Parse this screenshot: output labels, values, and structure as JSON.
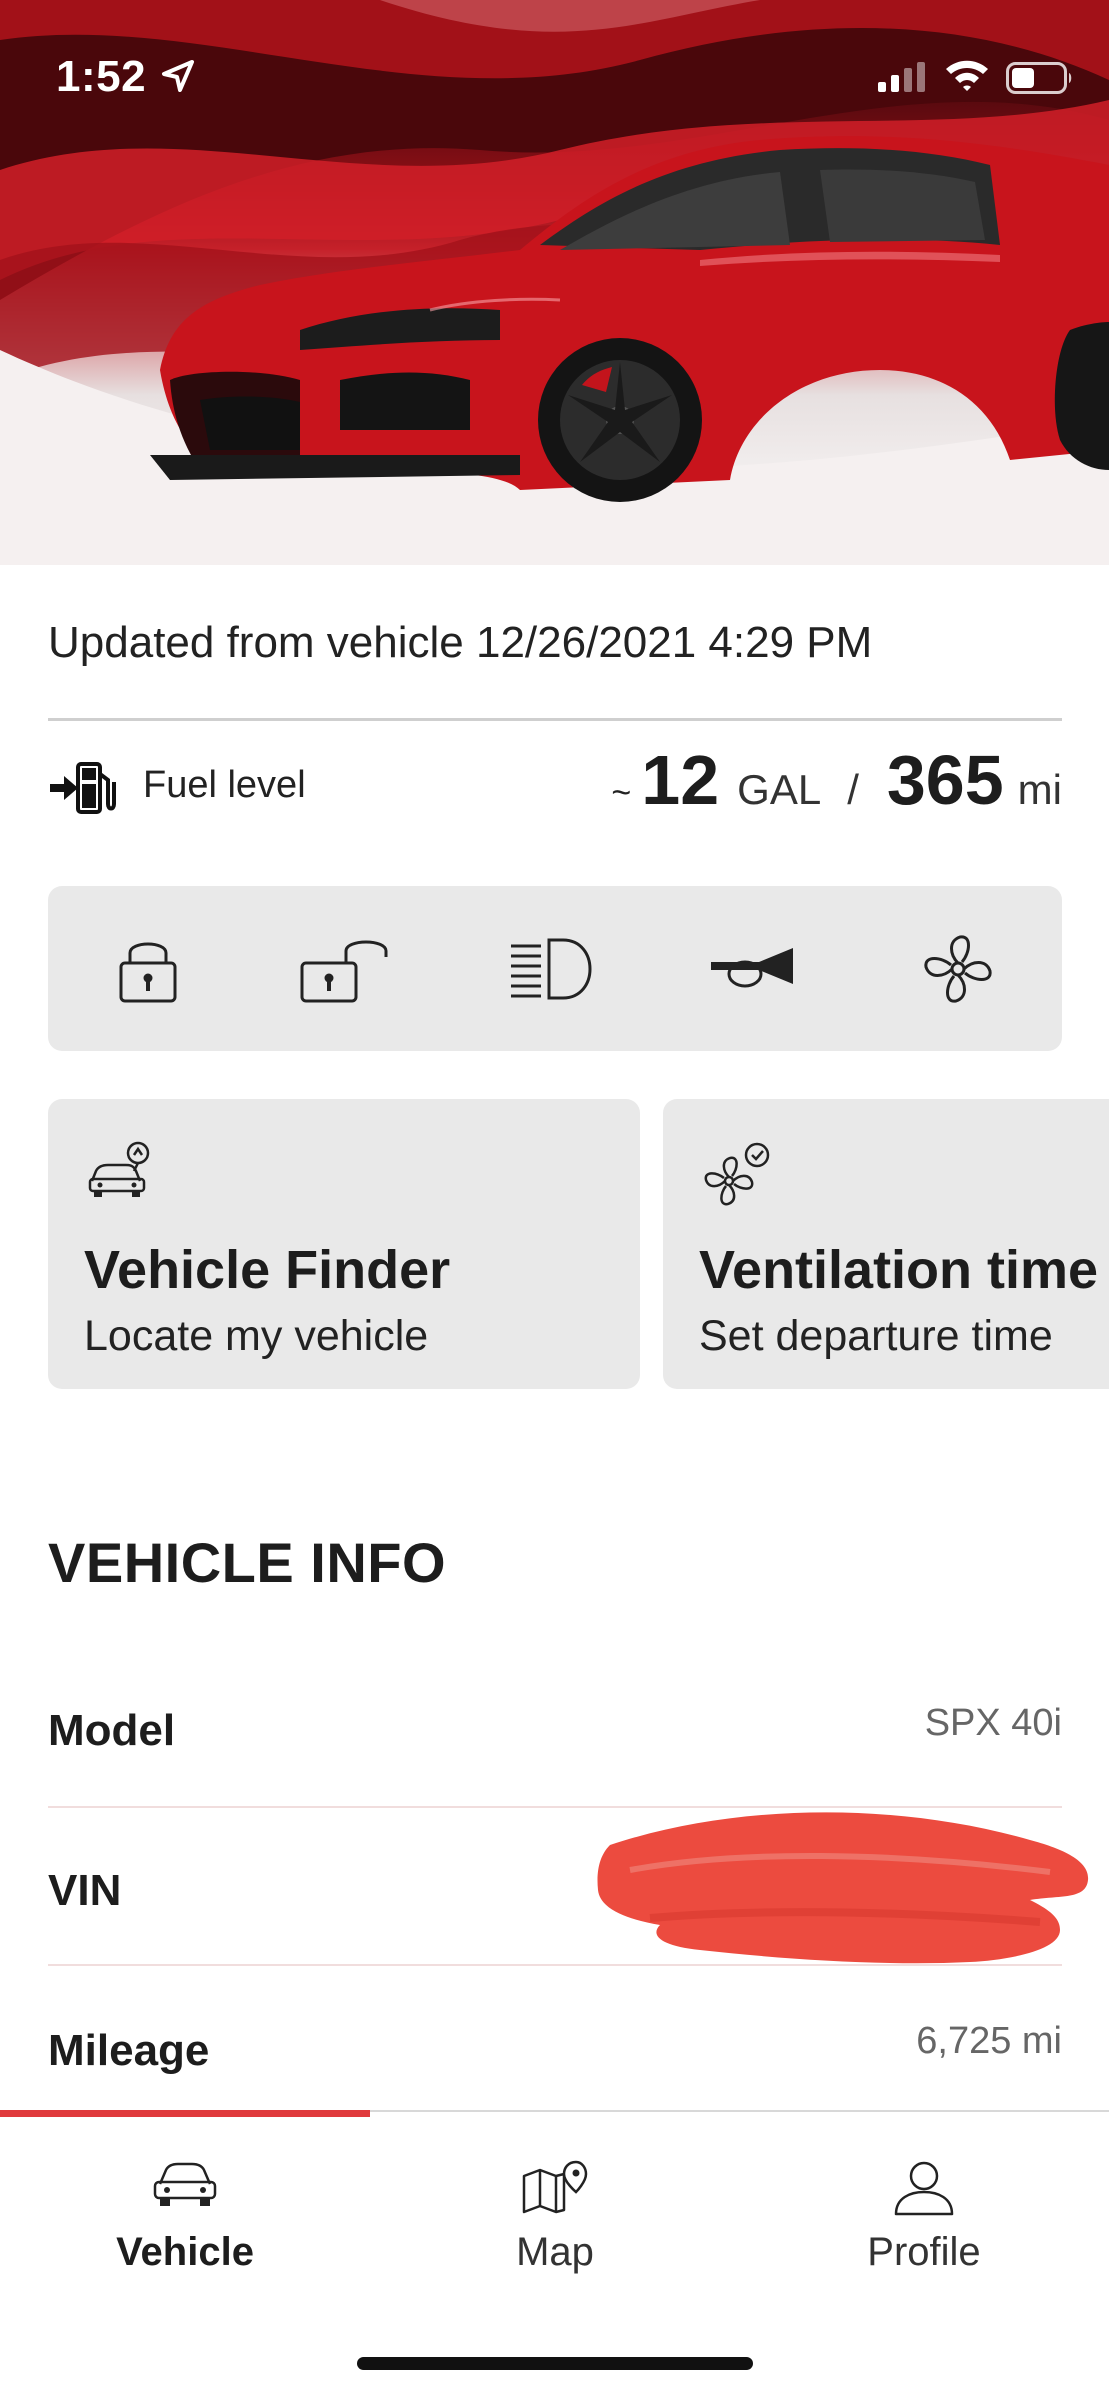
{
  "status_bar": {
    "time": "1:52"
  },
  "hero": {
    "image": "red sports car on red swirl background"
  },
  "updated_text": "Updated from vehicle 12/26/2021 4:29 PM",
  "fuel": {
    "label": "Fuel level",
    "approx_symbol": "~",
    "gallons": "12",
    "gallons_unit": "GAL",
    "separator": "/",
    "range": "365",
    "range_unit": "mi"
  },
  "controls": [
    {
      "name": "lock",
      "icon": "lock-icon"
    },
    {
      "name": "unlock",
      "icon": "unlock-icon"
    },
    {
      "name": "headlights",
      "icon": "headlight-icon"
    },
    {
      "name": "horn",
      "icon": "horn-icon"
    },
    {
      "name": "ventilation",
      "icon": "fan-icon"
    }
  ],
  "cards": [
    {
      "title": "Vehicle Finder",
      "subtitle": "Locate my vehicle",
      "icon": "car-locate-icon"
    },
    {
      "title": "Ventilation time",
      "subtitle": "Set departure time",
      "icon": "fan-clock-icon"
    }
  ],
  "vehicle_info": {
    "title": "VEHICLE INFO",
    "rows": [
      {
        "label": "Model",
        "value": "SPX 40i"
      },
      {
        "label": "VIN",
        "value": ""
      },
      {
        "label": "Mileage",
        "value": "6,725 mi"
      }
    ]
  },
  "tabs": [
    {
      "label": "Vehicle",
      "icon": "car-icon",
      "active": true
    },
    {
      "label": "Map",
      "icon": "map-icon",
      "active": false
    },
    {
      "label": "Profile",
      "icon": "profile-icon",
      "active": false
    }
  ],
  "colors": {
    "accent": "#e03a3c",
    "card_bg": "#e9e9e9",
    "redaction": "#ec4b3f"
  }
}
